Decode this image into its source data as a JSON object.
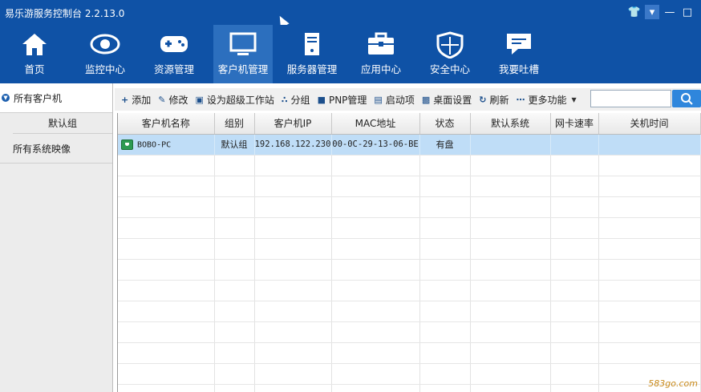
{
  "window": {
    "title": "易乐游服务控制台 2.2.13.0",
    "controls": [
      "skin-icon",
      "menu-icon",
      "minimize-icon",
      "maximize-icon"
    ]
  },
  "nav": {
    "items": [
      {
        "label": "首页",
        "icon": "home-icon"
      },
      {
        "label": "监控中心",
        "icon": "eye-icon"
      },
      {
        "label": "资源管理",
        "icon": "gamepad-icon"
      },
      {
        "label": "客户机管理",
        "icon": "monitor-icon",
        "selected": true
      },
      {
        "label": "服务器管理",
        "icon": "server-icon"
      },
      {
        "label": "应用中心",
        "icon": "toolbox-icon"
      },
      {
        "label": "安全中心",
        "icon": "shield-icon"
      },
      {
        "label": "我要吐槽",
        "icon": "chat-icon"
      }
    ]
  },
  "sidebar": {
    "root": "所有客户机",
    "group": "默认组",
    "images": "所有系统映像"
  },
  "toolbar": {
    "add": "添加",
    "edit": "修改",
    "super": "设为超级工作站",
    "group": "分组",
    "pnp": "PNP管理",
    "startup": "启动项",
    "desktop": "桌面设置",
    "refresh": "刷新",
    "more": "更多功能"
  },
  "search": {
    "value": ""
  },
  "table": {
    "headers": [
      "客户机名称",
      "组别",
      "客户机IP",
      "MAC地址",
      "状态",
      "默认系统",
      "网卡速率",
      "关机时间"
    ],
    "rows": [
      {
        "name": "BOBO-PC",
        "group": "默认组",
        "ip": "192.168.122.230",
        "mac": "00-0C-29-13-06-BE",
        "status": "有盘",
        "system": "",
        "speed": "",
        "shutdown": ""
      }
    ]
  },
  "watermark": "583go.com",
  "colors": {
    "header": "#0f52a6",
    "selected_nav": "#2c6fbe",
    "selected_row": "#bfddf7"
  }
}
